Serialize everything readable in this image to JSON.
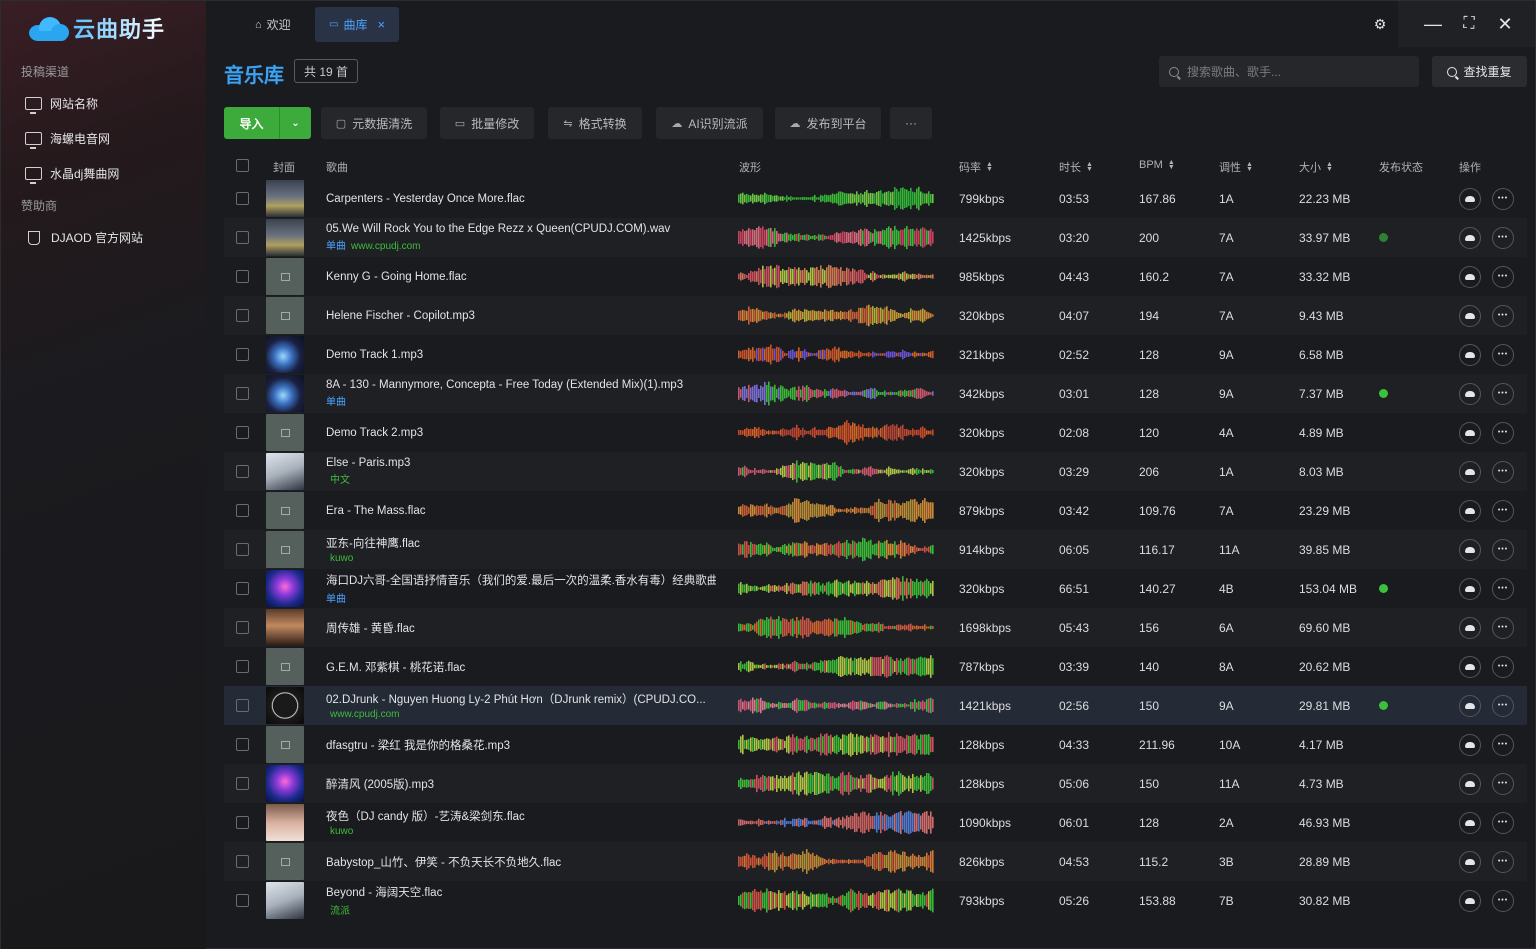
{
  "app": {
    "logo_text": "云曲助手",
    "tabs": [
      {
        "label": "欢迎",
        "icon": "home-icon"
      },
      {
        "label": "曲库",
        "icon": "monitor-icon",
        "close": "×"
      }
    ],
    "window_controls": {
      "settings": "⚙",
      "minimize": "—",
      "maximize": "⛶",
      "close": "✕"
    }
  },
  "sidebar": {
    "section1": "投稿渠道",
    "channels": [
      {
        "label": "网站名称"
      },
      {
        "label": "海螺电音网"
      },
      {
        "label": "水晶dj舞曲网"
      }
    ],
    "section2": "赞助商",
    "sponsors": [
      {
        "label": "DJAOD 官方网站"
      }
    ]
  },
  "header": {
    "title": "音乐库",
    "count": "共 19 首",
    "search_placeholder": "搜索歌曲、歌手...",
    "find_dup": "查找重复"
  },
  "toolbar": {
    "import": "导入",
    "import_dd": "⌄",
    "tools": [
      {
        "label": "元数据清洗",
        "icon": "document-icon",
        "glyph": "▢"
      },
      {
        "label": "批量修改",
        "icon": "folder-icon",
        "glyph": "▭"
      },
      {
        "label": "格式转换",
        "icon": "convert-icon",
        "glyph": "⇋"
      },
      {
        "label": "AI识别流派",
        "icon": "cloud-icon",
        "glyph": "☁"
      },
      {
        "label": "发布到平台",
        "icon": "cloud-upload-icon",
        "glyph": "☁"
      },
      {
        "label": "···",
        "icon": "more-icon",
        "glyph": ""
      }
    ]
  },
  "table": {
    "headers": {
      "cover": "封面",
      "song": "歌曲",
      "wave": "波形",
      "bitrate": "码率",
      "duration": "时长",
      "bpm": "BPM",
      "key": "调性",
      "size": "大小",
      "publish": "发布状态",
      "ops": "操作"
    },
    "colors": {
      "published": "#3cc13c",
      "accent": "#4aa3ff"
    },
    "rows": [
      {
        "name": "Carpenters - Yesterday Once More.flac",
        "tag": "",
        "bitrate": "799kbps",
        "duration": "03:53",
        "bpm": "167.86",
        "key": "1A",
        "size": "22.23 MB",
        "published": false,
        "cover": "photo-bw",
        "wave": [
          "#3fd23a",
          "#7be04a",
          "#2fc83a"
        ]
      },
      {
        "name": "05.We Will Rock You to the Edge Rezz x Queen(CPUDJ.COM).wav",
        "tag": "单曲",
        "tag2": "www.cpudj.com",
        "bitrate": "1425kbps",
        "duration": "03:20",
        "bpm": "200",
        "key": "7A",
        "size": "33.97 MB",
        "published": true,
        "dim": true,
        "cover": "photo-bw",
        "wave": [
          "#e84a6a",
          "#f07a8a",
          "#3fd23a"
        ]
      },
      {
        "name": "Kenny G - Going Home.flac",
        "tag": "",
        "bitrate": "985kbps",
        "duration": "04:43",
        "bpm": "160.2",
        "key": "7A",
        "size": "33.32 MB",
        "published": false,
        "cover": "blank",
        "wave": [
          "#f08a5a",
          "#e85a6a",
          "#c8e04a"
        ]
      },
      {
        "name": "Helene Fischer - Copilot.mp3",
        "tag": "",
        "bitrate": "320kbps",
        "duration": "04:07",
        "bpm": "194",
        "key": "7A",
        "size": "9.43 MB",
        "published": false,
        "cover": "blank",
        "wave": [
          "#f09a3a",
          "#e86a3a",
          "#d0c03a"
        ]
      },
      {
        "name": "Demo Track 1.mp3",
        "tag": "",
        "bitrate": "321kbps",
        "duration": "02:52",
        "bpm": "128",
        "key": "9A",
        "size": "6.58 MB",
        "published": false,
        "cover": "planet",
        "wave": [
          "#f0702a",
          "#e85a2a",
          "#7a5af0"
        ]
      },
      {
        "name": "8A - 130 - Mannymore, Concepta - Free Today (Extended Mix)(1).mp3",
        "tag": "单曲",
        "bitrate": "342kbps",
        "duration": "03:01",
        "bpm": "128",
        "key": "9A",
        "size": "7.37 MB",
        "published": true,
        "cover": "planet",
        "wave": [
          "#e8607a",
          "#8a7af0",
          "#3fd23a"
        ]
      },
      {
        "name": "Demo Track 2.mp3",
        "tag": "",
        "bitrate": "320kbps",
        "duration": "02:08",
        "bpm": "120",
        "key": "4A",
        "size": "4.89 MB",
        "published": false,
        "cover": "blank",
        "wave": [
          "#e8502a",
          "#f0702a",
          "#d04a3a"
        ]
      },
      {
        "name": "Else - Paris.mp3",
        "tag": "中文",
        "bitrate": "320kbps",
        "duration": "03:29",
        "bpm": "206",
        "key": "1A",
        "size": "8.03 MB",
        "published": false,
        "cover": "photo-light",
        "wave": [
          "#3fd23a",
          "#e8607a",
          "#c8e04a"
        ]
      },
      {
        "name": "Era - The Mass.flac",
        "tag": "",
        "bitrate": "879kbps",
        "duration": "03:42",
        "bpm": "109.76",
        "key": "7A",
        "size": "23.29 MB",
        "published": false,
        "cover": "blank",
        "wave": [
          "#f09a3a",
          "#e86a3a",
          "#c8a03a"
        ]
      },
      {
        "name": "亚东-向往神鹰.flac",
        "tag": "kuwo",
        "bitrate": "914kbps",
        "duration": "06:05",
        "bpm": "116.17",
        "key": "11A",
        "size": "39.85 MB",
        "published": false,
        "cover": "blank",
        "wave": [
          "#e85a4a",
          "#3fd23a",
          "#f09a3a"
        ]
      },
      {
        "name": "海口DJ六哥-全国语抒情音乐（我们的爱.最后一次的温柔.香水有毒）经典歌曲...",
        "tag": "单曲",
        "bitrate": "320kbps",
        "duration": "66:51",
        "bpm": "140.27",
        "key": "4B",
        "size": "153.04 MB",
        "published": true,
        "cover": "neon",
        "wave": [
          "#3fd23a",
          "#c8e04a",
          "#f07a5a"
        ]
      },
      {
        "name": "周传雄 - 黄昏.flac",
        "tag": "",
        "bitrate": "1698kbps",
        "duration": "05:43",
        "bpm": "156",
        "key": "6A",
        "size": "69.60 MB",
        "published": false,
        "cover": "photo-warm",
        "wave": [
          "#f0702a",
          "#3fd23a",
          "#e8604a"
        ]
      },
      {
        "name": "G.E.M. 邓紫棋 - 桃花诺.flac",
        "tag": "",
        "bitrate": "787kbps",
        "duration": "03:39",
        "bpm": "140",
        "key": "8A",
        "size": "20.62 MB",
        "published": false,
        "cover": "blank",
        "wave": [
          "#3fd23a",
          "#c8e04a",
          "#e85a6a"
        ]
      },
      {
        "name": "02.DJrunk - Nguyen Huong Ly-2 Phút Hơn（DJrunk remix）(CPUDJ.CO...",
        "tag": "www.cpudj.com",
        "bitrate": "1421kbps",
        "duration": "02:56",
        "bpm": "150",
        "key": "9A",
        "size": "29.81 MB",
        "published": true,
        "cover": "cpudj",
        "highlight": true,
        "wave": [
          "#e85a7a",
          "#f08a9a",
          "#3fd23a"
        ]
      },
      {
        "name": "dfasgtru - 梁红 我是你的格桑花.mp3",
        "tag": "",
        "bitrate": "128kbps",
        "duration": "04:33",
        "bpm": "211.96",
        "key": "10A",
        "size": "4.17 MB",
        "published": false,
        "cover": "blank",
        "wave": [
          "#3fd23a",
          "#c8e04a",
          "#e85a6a"
        ]
      },
      {
        "name": "醉清风 (2005版).mp3",
        "tag": "",
        "bitrate": "128kbps",
        "duration": "05:06",
        "bpm": "150",
        "key": "11A",
        "size": "4.73 MB",
        "published": false,
        "cover": "neon",
        "wave": [
          "#3fd23a",
          "#e85a6a",
          "#c8e04a"
        ]
      },
      {
        "name": "夜色（DJ candy 版）-艺涛&梁剑东.flac",
        "tag": "kuwo",
        "bitrate": "1090kbps",
        "duration": "06:01",
        "bpm": "128",
        "key": "2A",
        "size": "46.93 MB",
        "published": false,
        "cover": "photo-skin",
        "wave": [
          "#f07a7a",
          "#e86a6a",
          "#5a8af0"
        ]
      },
      {
        "name": "Babystop_山竹、伊笑 - 不负天长不负地久.flac",
        "tag": "",
        "bitrate": "826kbps",
        "duration": "04:53",
        "bpm": "115.2",
        "key": "3B",
        "size": "28.89 MB",
        "published": false,
        "cover": "blank",
        "wave": [
          "#f08a3a",
          "#e85a3a",
          "#d0a03a"
        ]
      },
      {
        "name": "Beyond - 海阔天空.flac",
        "tag": "流派",
        "bitrate": "793kbps",
        "duration": "05:26",
        "bpm": "153.88",
        "key": "7B",
        "size": "30.82 MB",
        "published": false,
        "cover": "photo-light",
        "wave": [
          "#3fd23a",
          "#e85a4a",
          "#c8e04a"
        ]
      }
    ]
  }
}
